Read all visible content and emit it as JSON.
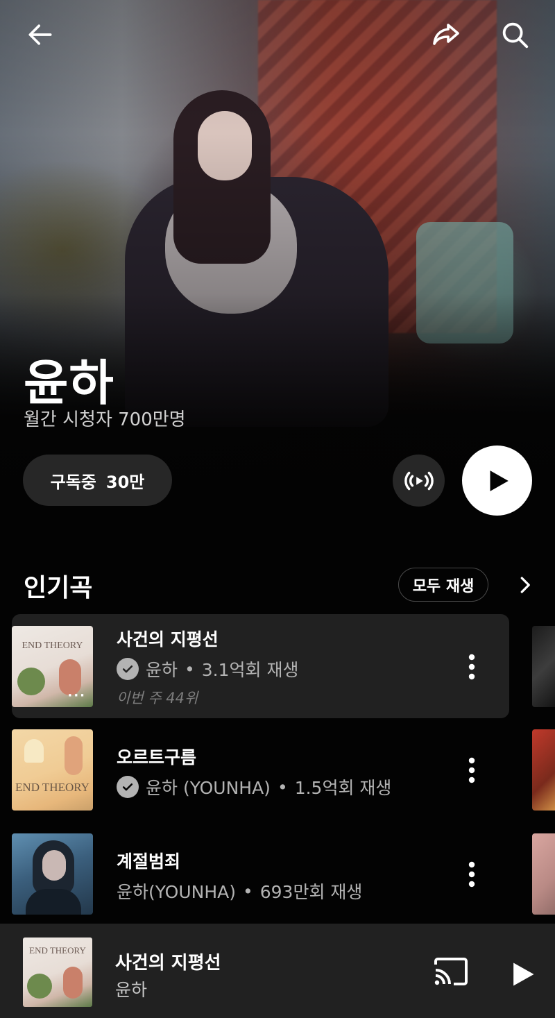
{
  "header": {
    "back_icon": "arrow-left-icon",
    "share_icon": "share-icon",
    "search_icon": "search-icon"
  },
  "artist": {
    "name": "윤하",
    "monthly_listeners": "월간 시청자 700만명"
  },
  "actions": {
    "subscribe_label": "구독중",
    "subscriber_count": "30만",
    "radio_icon": "radio-broadcast-icon",
    "play_icon": "play-icon"
  },
  "popular": {
    "title": "인기곡",
    "play_all_label": "모두 재생",
    "songs": [
      {
        "title": "사건의 지평선",
        "artist": "윤하",
        "plays": "3.1억회 재생",
        "verified": true,
        "rank": "이번 주 44위",
        "thumb_caption": "END THEORY"
      },
      {
        "title": "오르트구름",
        "artist": "윤하 (YOUNHA)",
        "plays": "1.5억회 재생",
        "verified": true,
        "thumb_caption": "END THEORY"
      },
      {
        "title": "계절범죄",
        "artist": "윤하(YOUNHA)",
        "plays": "693만회 재생",
        "verified": false
      }
    ]
  },
  "mini_player": {
    "title": "사건의 지평선",
    "artist": "윤하",
    "thumb_caption": "END THEORY",
    "cast_icon": "cast-icon",
    "play_icon": "play-icon"
  },
  "colors": {
    "background": "#030303",
    "surface": "#212121",
    "button_bg": "#272727",
    "secondary_text": "#b3b3b3"
  }
}
